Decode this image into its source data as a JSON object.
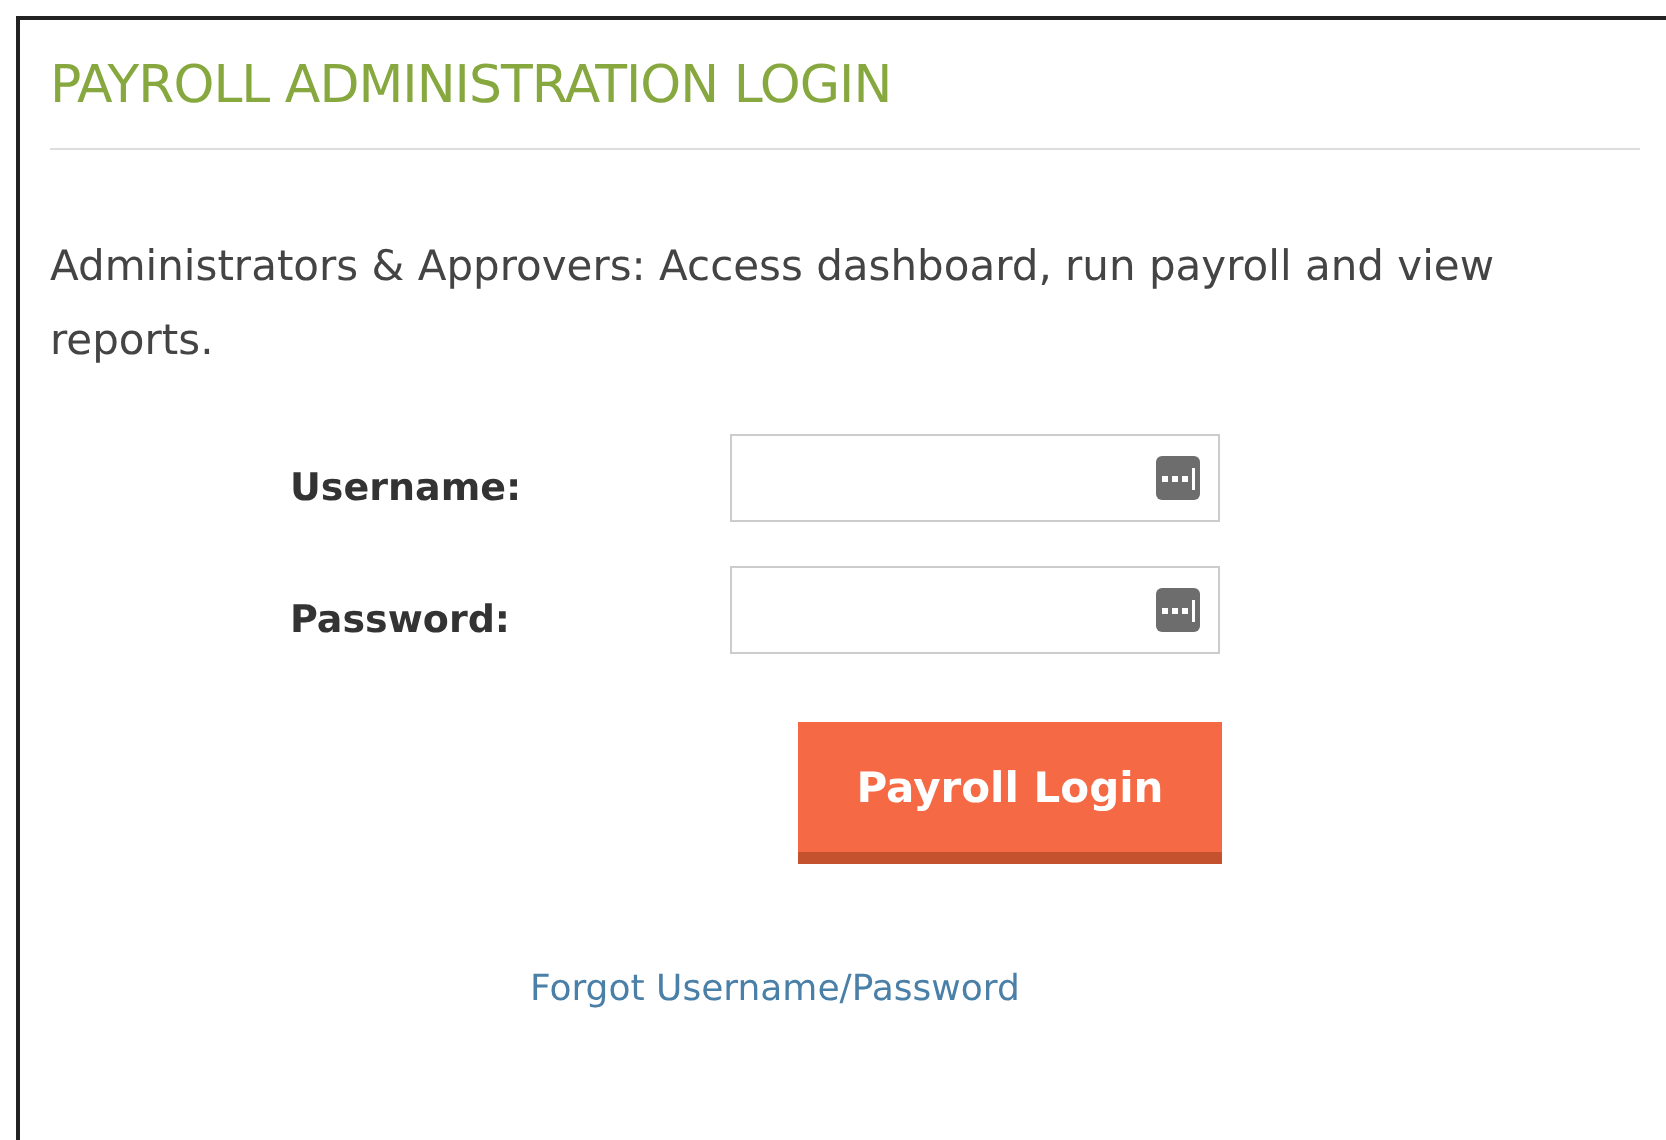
{
  "title": "PAYROLL ADMINISTRATION LOGIN",
  "intro": "Administrators & Approvers: Access dashboard, run payroll and view reports.",
  "fields": [
    {
      "label": "Username:"
    },
    {
      "label": "Password:"
    }
  ],
  "login_button": "Payroll Login",
  "forgot_link": "Forgot Username/Password"
}
